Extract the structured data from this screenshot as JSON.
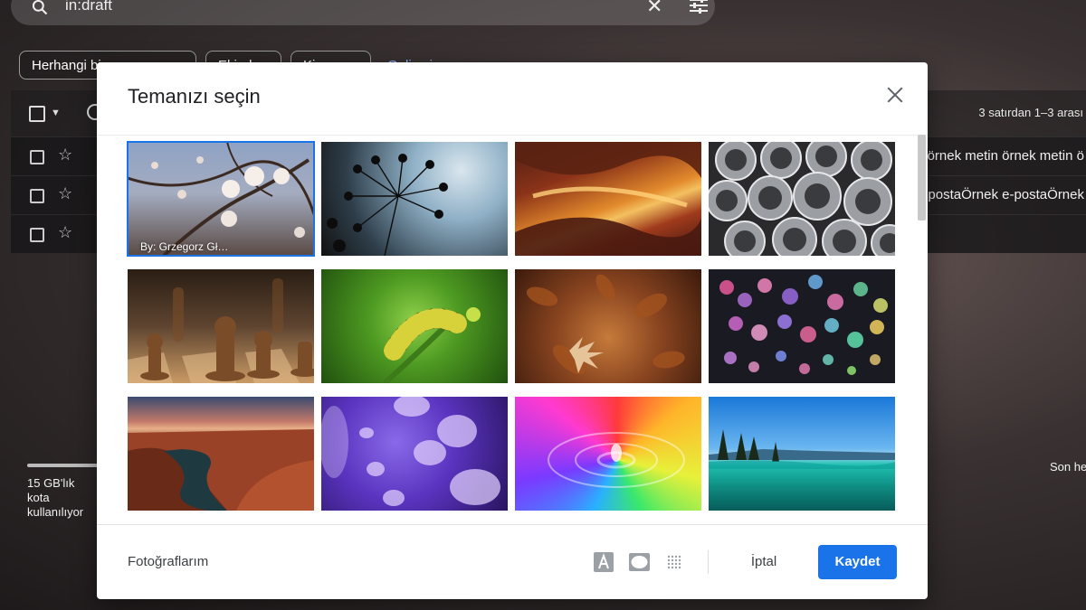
{
  "search": {
    "query": "in:draft"
  },
  "filters": {
    "chips": [
      "Herhangi bir zaman",
      "Ekinde",
      "Kime"
    ],
    "advanced_link": "Gelişmiş arama"
  },
  "toolbar": {
    "page_count": "3 satırdan 1–3 arası"
  },
  "mail_rows": [
    {
      "snippet": "örnek metin örnek metin ö"
    },
    {
      "snippet": "postaÖrnek e-postaÖrnek"
    },
    {
      "snippet": ""
    }
  ],
  "storage": {
    "text": "15 GB'lık kota kullanılıyor"
  },
  "last_activity": "Son he",
  "modal": {
    "title": "Temanızı seçin",
    "thumbnails": [
      {
        "theme": "cherry-blossom",
        "credit": "By: Grzegorz Gł…",
        "selected": true
      },
      {
        "theme": "dandelion-silhouette",
        "credit": ""
      },
      {
        "theme": "canyon-waves",
        "credit": ""
      },
      {
        "theme": "metal-pipes",
        "credit": ""
      },
      {
        "theme": "chess-pieces",
        "credit": ""
      },
      {
        "theme": "caterpillar",
        "credit": ""
      },
      {
        "theme": "autumn-leaves",
        "credit": ""
      },
      {
        "theme": "bokeh-lights",
        "credit": ""
      },
      {
        "theme": "grand-canyon",
        "credit": ""
      },
      {
        "theme": "jellyfish",
        "credit": ""
      },
      {
        "theme": "water-drop",
        "credit": ""
      },
      {
        "theme": "lake-tahoe",
        "credit": ""
      }
    ],
    "my_photos": "Fotoğraflarım",
    "cancel": "İptal",
    "save": "Kaydet"
  },
  "icons": [
    "search-icon",
    "clear-icon",
    "search-options-icon",
    "close-icon",
    "text-background-icon",
    "vignette-icon",
    "blur-icon",
    "star-icon",
    "refresh-icon"
  ],
  "colors": {
    "primary": "#1a73e8",
    "link": "#8ab4f8"
  }
}
